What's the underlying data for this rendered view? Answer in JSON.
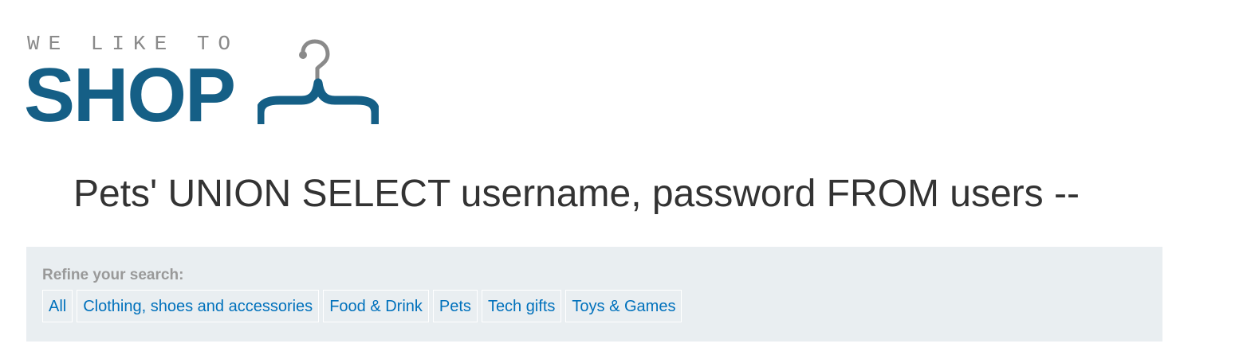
{
  "logo": {
    "tagline": "WE LIKE TO",
    "word": "SHOP",
    "icon": "clothes-hanger-icon",
    "colors": {
      "word": "#155f86",
      "tagline": "#8a8a8a",
      "hook": "#8a8a8a"
    }
  },
  "heading": {
    "text": "Pets' UNION SELECT username, password FROM users --"
  },
  "filters": {
    "title": "Refine your search:",
    "items": [
      {
        "label": "All"
      },
      {
        "label": "Clothing, shoes and accessories"
      },
      {
        "label": "Food & Drink"
      },
      {
        "label": "Pets"
      },
      {
        "label": "Tech gifts"
      },
      {
        "label": "Toys & Games"
      }
    ],
    "colors": {
      "panel_bg": "#e9eef1",
      "link": "#0071bc",
      "title": "#999999"
    }
  }
}
